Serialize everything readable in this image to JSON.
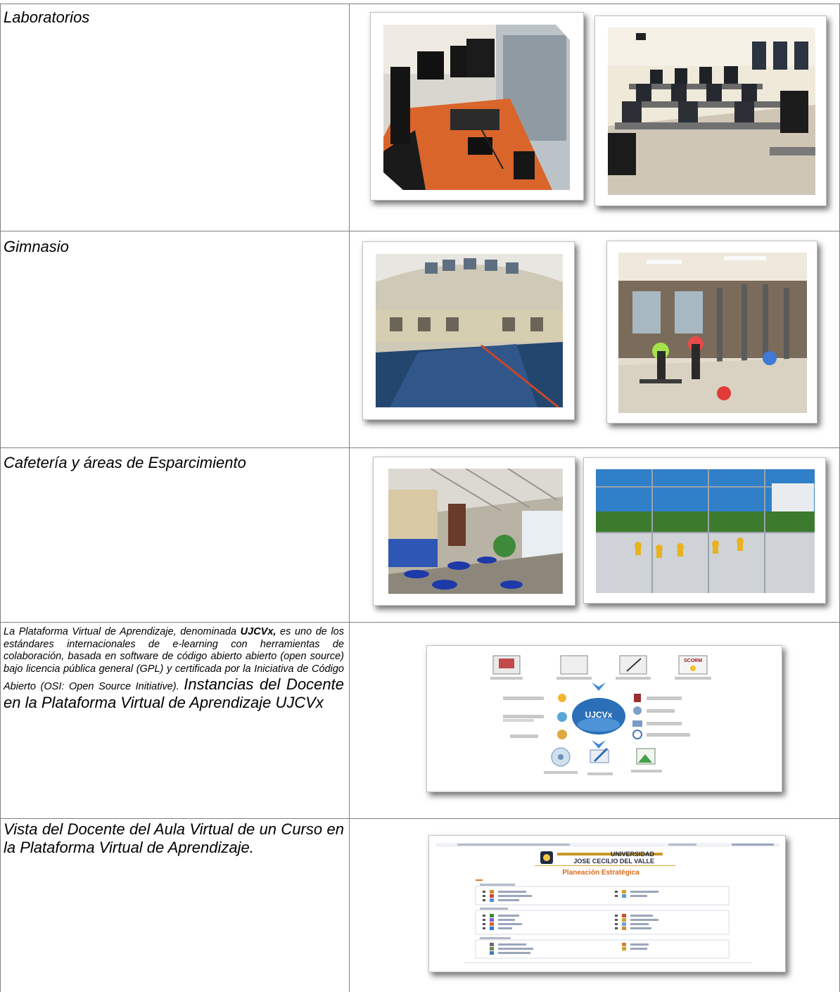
{
  "rows": [
    {
      "label": "Laboratorios"
    },
    {
      "label": "Gimnasio"
    },
    {
      "label": "Cafetería y áreas de Esparcimiento"
    },
    {
      "text_part1": "La Plataforma Virtual de Aprendizaje, denominada ",
      "text_bold": "UJCVx,",
      "text_part2": " es uno de los estándares internacionales de e-learning con herramientas de colaboración, basada en software de código abierto abierto (open source) bajo licencia pública general (GPL) y certificada por la Iniciativa de Código Abierto (OSI: Open Source Initiative). ",
      "text_large": "Instancias del Docente en la Plataforma Virtual de Aprendizaje UJCVx"
    },
    {
      "label": "Vista del Docente del Aula Virtual de un Curso en la Plataforma Virtual de Aprendizaje."
    }
  ],
  "diagram": {
    "center_label": "UJCVx",
    "top_badge": "SCORM"
  },
  "screenshot": {
    "brand_line1": "UNIVERSIDAD",
    "brand_line2": "JOSE CECILIO DEL VALLE",
    "heading": "Planeación Estratégica"
  }
}
